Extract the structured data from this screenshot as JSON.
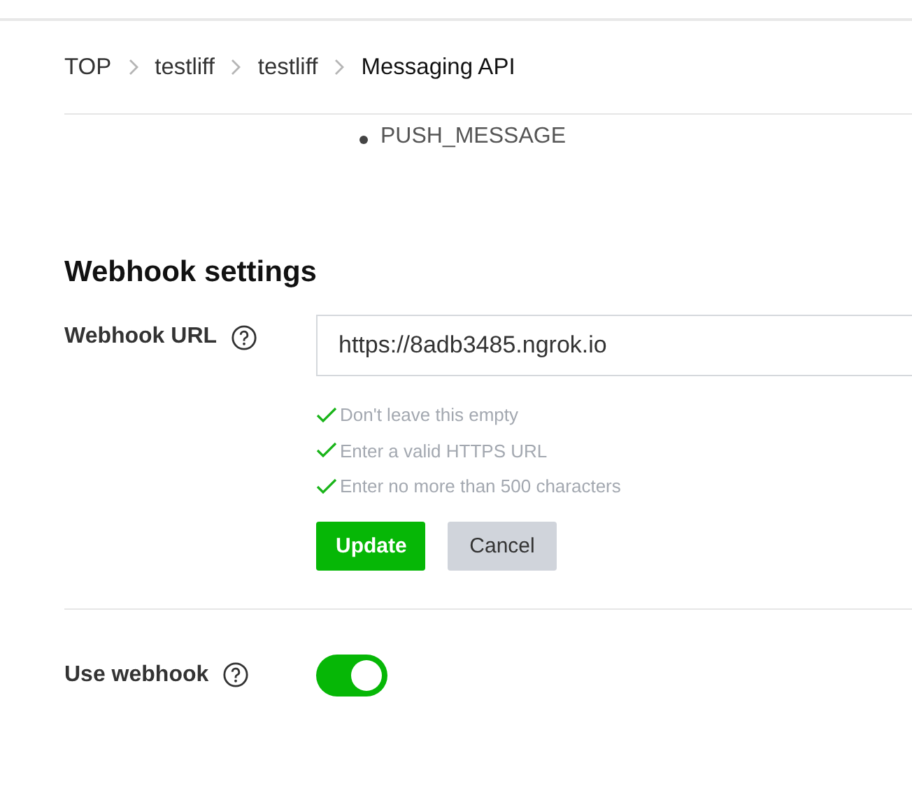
{
  "breadcrumb": [
    "TOP",
    "testliff",
    "testliff"
  ],
  "breadcrumb_current": "Messaging API",
  "list_items": [
    "PUSH_MESSAGE"
  ],
  "section_title": "Webhook settings",
  "webhook_url": {
    "label": "Webhook URL",
    "value": "https://8adb3485.ngrok.io",
    "validations": [
      {
        "text": "Don't leave this empty",
        "valid": true
      },
      {
        "text": "Enter a valid HTTPS URL",
        "valid": true
      },
      {
        "text": "Enter no more than 500 characters",
        "valid": true
      }
    ],
    "buttons": [
      {
        "label": "Update",
        "kind": "primary"
      },
      {
        "label": "Cancel",
        "kind": "secondary"
      }
    ]
  },
  "use_webhook": {
    "label": "Use webhook",
    "on": true
  }
}
